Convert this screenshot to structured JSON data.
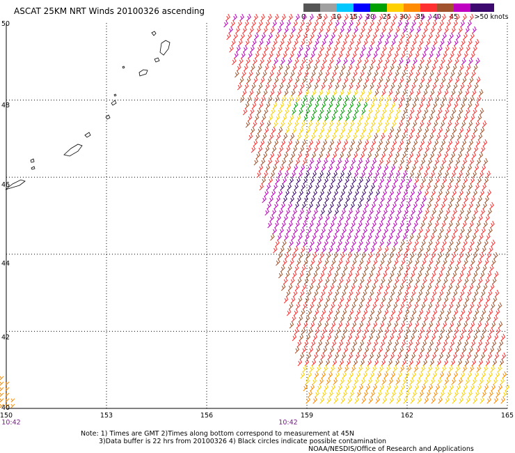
{
  "title": "ASCAT 25KM NRT Winds 20100326 ascending",
  "legend": {
    "colors": [
      "#555555",
      "#a0a0a0",
      "#00c8ff",
      "#0000ff",
      "#00a000",
      "#ffd000",
      "#ff8c00",
      "#ff3030",
      "#a0522d",
      "#c000c0",
      "#3c0a6e"
    ],
    "labels": [
      "0",
      "5",
      "10",
      "15",
      "20",
      "25",
      "30",
      "35",
      "40",
      "45",
      ">50 knots"
    ]
  },
  "axes": {
    "lat_labels": [
      "50",
      "48",
      "46",
      "44",
      "42",
      "40"
    ],
    "lon_labels": [
      "150",
      "153",
      "156",
      "159",
      "162",
      "165"
    ],
    "lat_range": [
      40,
      50
    ],
    "lon_range": [
      150,
      165
    ],
    "grid": "dotted"
  },
  "times": [
    "10:42",
    "10:42"
  ],
  "notes": {
    "line1": "Note: 1) Times are GMT 2)Times along bottom correspond to measurement at 45N",
    "line2": "3)Data buffer is 22 hrs from 20100326 4) Black circles indicate possible contamination",
    "credit": "NOAA/NESDIS/Office of Research and Applications"
  }
}
